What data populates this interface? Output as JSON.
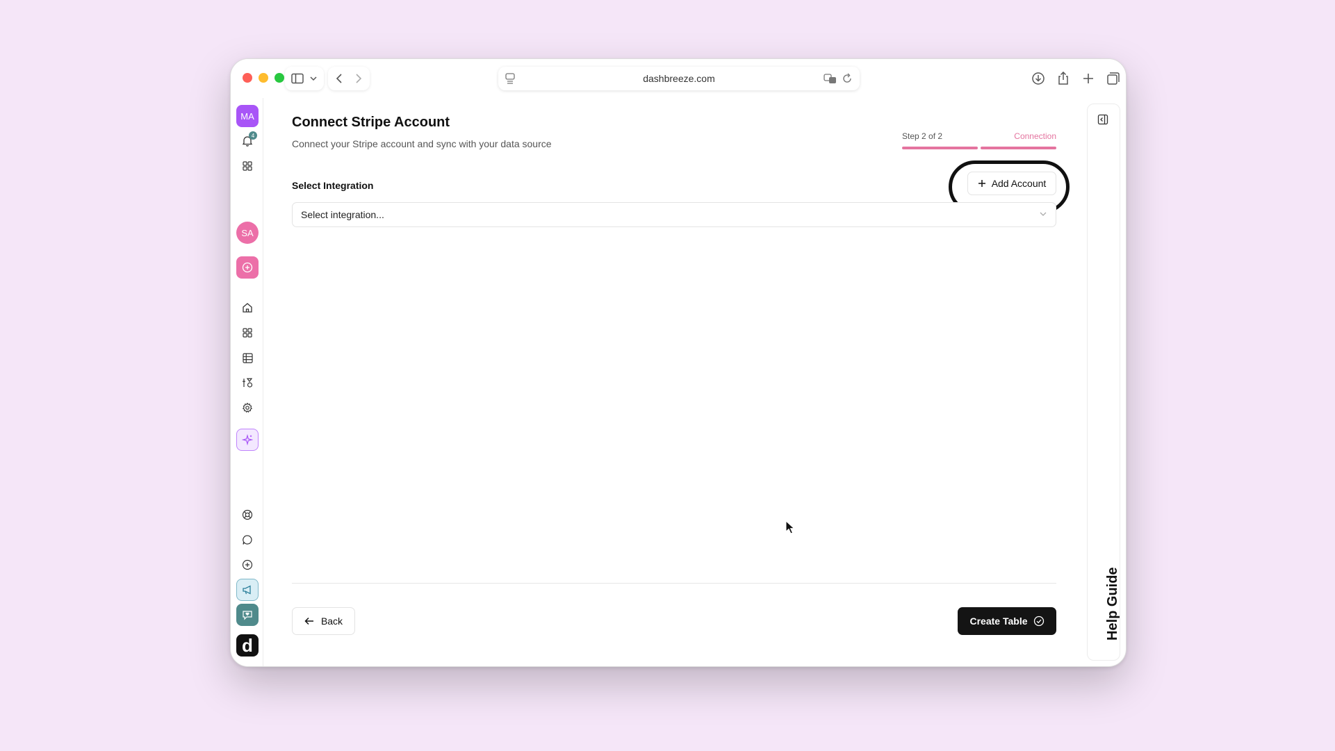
{
  "browser": {
    "url": "dashbreeze.com"
  },
  "rail": {
    "top_avatar": "MA",
    "notification_count": "4",
    "workspace_avatar": "SA",
    "logo_letter": "d"
  },
  "page": {
    "title": "Connect Stripe Account",
    "subtitle": "Connect your Stripe account and sync with your data source"
  },
  "stepper": {
    "step_text": "Step 2 of 2",
    "step_name": "Connection",
    "progress_fraction": 1.0
  },
  "integration": {
    "label": "Select Integration",
    "add_account_label": "Add Account",
    "select_placeholder": "Select integration..."
  },
  "footer": {
    "back_label": "Back",
    "create_label": "Create Table"
  },
  "help": {
    "label": "Help Guide"
  },
  "colors": {
    "page_bg": "#f5e6f8",
    "accent_pink": "#e4749f",
    "avatar_purple": "#a855f7",
    "avatar_pink": "#ec6fa8",
    "primary_button": "#141414"
  }
}
